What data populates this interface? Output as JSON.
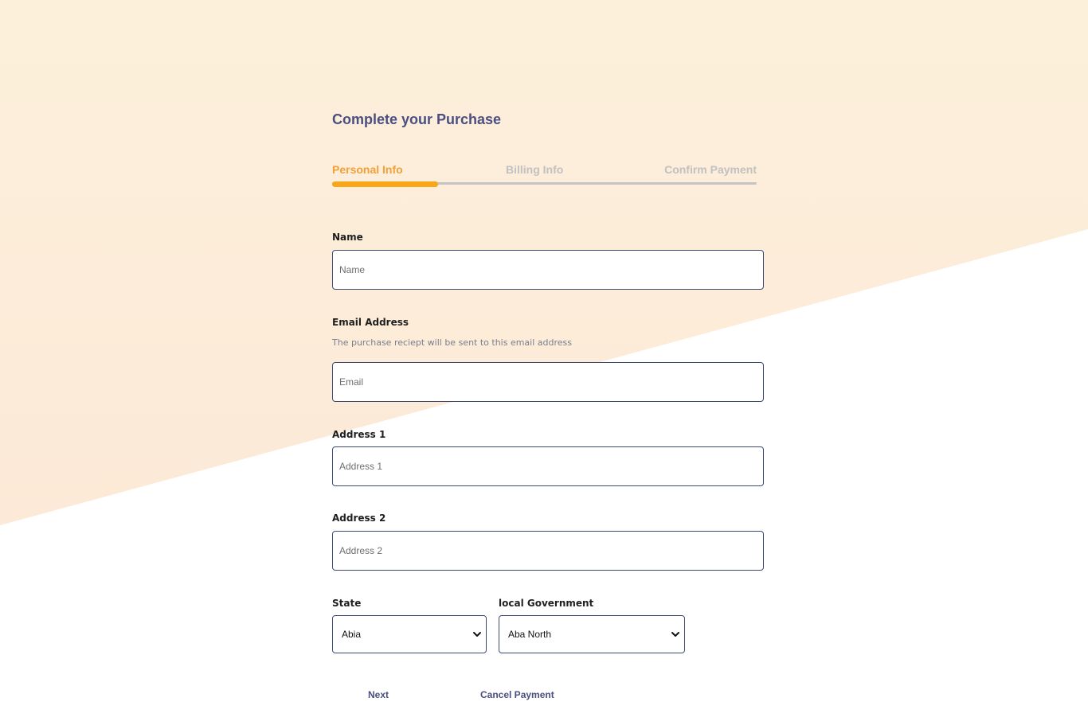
{
  "colors": {
    "accent": "#f9a71a",
    "accent_text": "#f2a03a",
    "title": "#4a4f80",
    "inactive_step": "#c2c0c0",
    "background_shape": "#fcefd9",
    "input_border": "#3e4a72"
  },
  "page": {
    "title": "Complete your Purchase"
  },
  "stepper": {
    "steps": [
      "Personal Info",
      "Billing Info",
      "Confirm Payment"
    ],
    "active_step": "Personal Info",
    "progress": 0.25
  },
  "form": {
    "name": {
      "label": "Name",
      "placeholder": "Name",
      "value": ""
    },
    "email": {
      "label": "Email Address",
      "hint": "The purchase reciept will be sent to this email address",
      "placeholder": "Email",
      "value": ""
    },
    "address1": {
      "label": "Address 1",
      "placeholder": "Address 1",
      "value": ""
    },
    "address2": {
      "label": "Address 2",
      "placeholder": "Address 2",
      "value": ""
    },
    "state": {
      "label": "State",
      "selected": "Abia",
      "icon": "chevron-down-icon"
    },
    "local_government": {
      "label": "local Government",
      "selected": "Aba North",
      "icon": "chevron-down-icon"
    }
  },
  "actions": {
    "next_label": "Next",
    "cancel_label": "Cancel Payment"
  }
}
